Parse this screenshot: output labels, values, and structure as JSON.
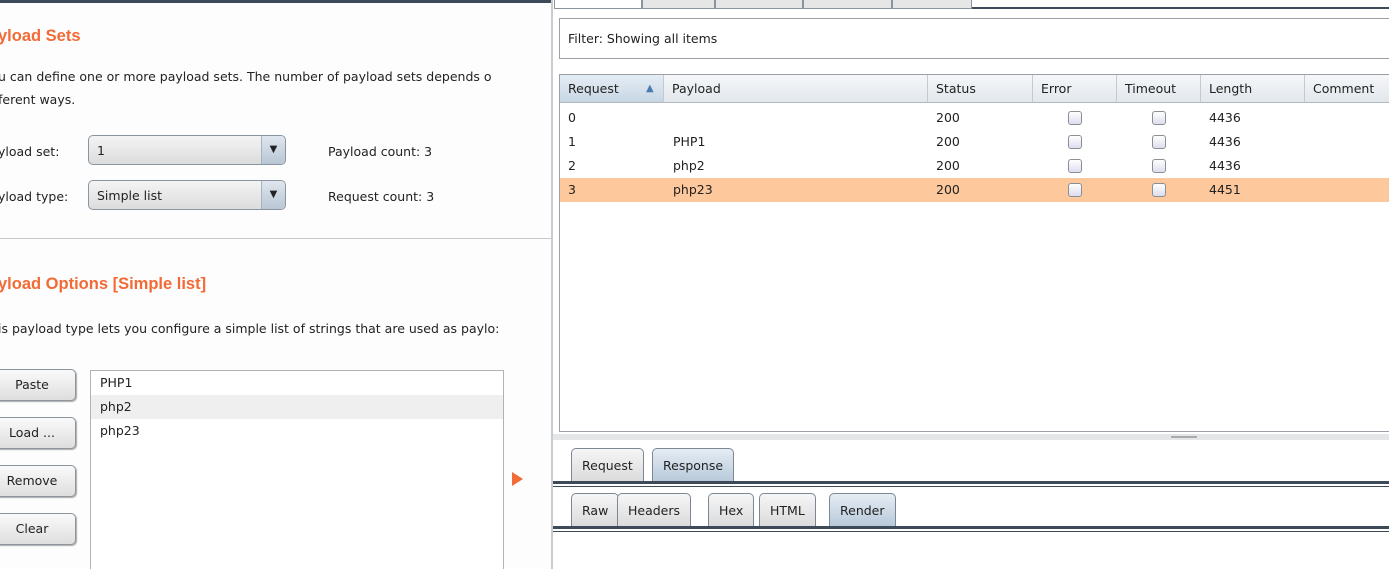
{
  "left": {
    "payload_sets_title": "yload Sets",
    "payload_sets_desc_line1": "u can define one or more payload sets. The number of payload sets depends o",
    "payload_sets_desc_line2": "ferent ways.",
    "payload_set_label": "yload set:",
    "payload_set_value": "1",
    "payload_type_label": "yload type:",
    "payload_type_value": "Simple list",
    "payload_count": "Payload count: 3",
    "request_count": "Request count: 3",
    "options_title": "yload Options [Simple list]",
    "options_desc": "is payload type lets you configure a simple list of strings that are used as paylo:",
    "buttons": [
      "Paste",
      "Load ...",
      "Remove",
      "Clear"
    ],
    "list_items": [
      "PHP1",
      "php2",
      "php23"
    ],
    "accent_color": "#f26a35"
  },
  "right": {
    "filter": "Filter: Showing all items",
    "columns": [
      "Request",
      "Payload",
      "Status",
      "Error",
      "Timeout",
      "Length",
      "Comment"
    ],
    "sort_indicator": "▲",
    "rows": [
      {
        "request": "0",
        "payload": "",
        "status": "200",
        "error": false,
        "timeout": false,
        "length": "4436"
      },
      {
        "request": "1",
        "payload": "PHP1",
        "status": "200",
        "error": false,
        "timeout": false,
        "length": "4436"
      },
      {
        "request": "2",
        "payload": "php2",
        "status": "200",
        "error": false,
        "timeout": false,
        "length": "4436"
      },
      {
        "request": "3",
        "payload": "php23",
        "status": "200",
        "error": false,
        "timeout": false,
        "length": "4451",
        "selected": true
      }
    ],
    "selected_row_color": "#fdc89b",
    "detail_tabs": [
      "Request",
      "Response"
    ],
    "detail_tab_selected": "Response",
    "view_tabs": [
      "Raw",
      "Headers",
      "Hex",
      "HTML",
      "Render"
    ],
    "view_tab_selected": "Render"
  }
}
